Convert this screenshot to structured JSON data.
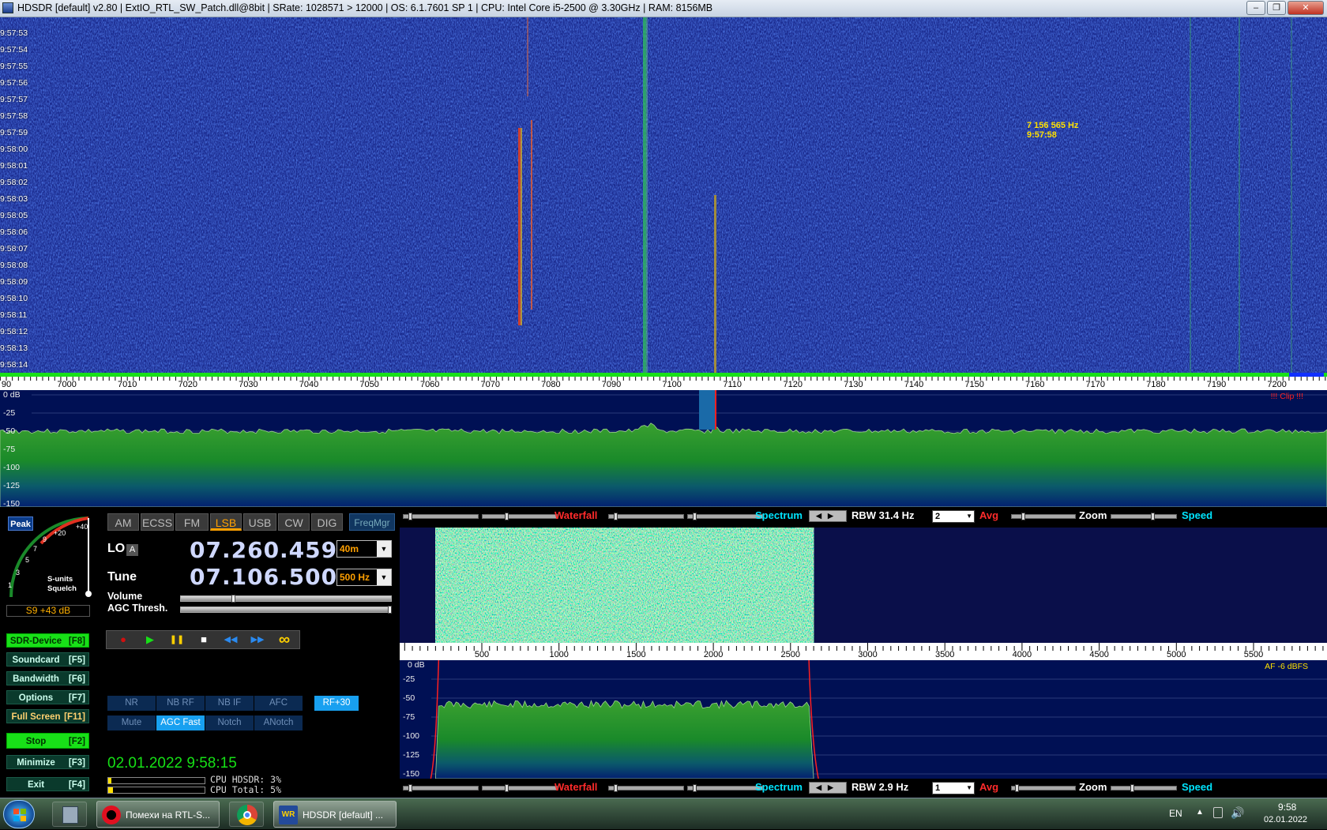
{
  "window": {
    "title": "HDSDR  [default]  v2.80   |  ExtIO_RTL_SW_Patch.dll@8bit  |  SRate: 1028571 > 12000  |  OS: 6.1.7601 SP 1  |  CPU: Intel Core i5-2500 @ 3.30GHz  |  RAM: 8156MB",
    "min_glyph": "–",
    "max_glyph": "❐",
    "close_glyph": "✕"
  },
  "waterfall": {
    "time_labels": [
      "9:57:53",
      "9:57:54",
      "9:57:55",
      "9:57:56",
      "9:57:57",
      "9:57:58",
      "9:57:59",
      "9:58:00",
      "9:58:01",
      "9:58:02",
      "9:58:03",
      "9:58:05",
      "9:58:06",
      "9:58:07",
      "9:58:08",
      "9:58:09",
      "9:58:10",
      "9:58:11",
      "9:58:12",
      "9:58:13",
      "9:58:14"
    ],
    "readout_freq": "7 156 565 Hz",
    "readout_time": "9:57:58"
  },
  "rf_scale": {
    "labels": [
      "90",
      "7000",
      "7010",
      "7020",
      "7030",
      "7040",
      "7050",
      "7060",
      "7070",
      "7080",
      "7090",
      "7100",
      "7110",
      "7120",
      "7130",
      "7140",
      "7150",
      "7160",
      "7170",
      "7180",
      "7190",
      "7200"
    ]
  },
  "rf_spectrum": {
    "db_labels": [
      "0 dB",
      "-25",
      "-50",
      "-75",
      "-100",
      "-125",
      "-150"
    ],
    "clip": "!!! Clip !!!"
  },
  "smeter": {
    "peak": "Peak",
    "scale": [
      "1",
      "3",
      "5",
      "7",
      "9",
      "+20",
      "+40"
    ],
    "caption1": "S-units",
    "caption2": "Squelch",
    "value": "S9 +43 dB"
  },
  "side_buttons": [
    {
      "label": "SDR-Device",
      "key": "[F8]"
    },
    {
      "label": "Soundcard",
      "key": "[F5]"
    },
    {
      "label": "Bandwidth",
      "key": "[F6]"
    },
    {
      "label": "Options",
      "key": "[F7]"
    },
    {
      "label": "Full Screen",
      "key": "[F11]"
    },
    {
      "label": "Stop",
      "key": "[F2]"
    },
    {
      "label": "Minimize",
      "key": "[F3]"
    },
    {
      "label": "Exit",
      "key": "[F4]"
    }
  ],
  "modes": [
    "AM",
    "ECSS",
    "FM",
    "LSB",
    "USB",
    "CW",
    "DIG"
  ],
  "freqmgr": "FreqMgr",
  "lo": {
    "label": "LO",
    "badge": "A",
    "value": "07.260.459",
    "band": "40m"
  },
  "tune": {
    "label": "Tune",
    "value": "07.106.500",
    "step": "500 Hz"
  },
  "volume_label": "Volume",
  "agc_label": "AGC Thresh.",
  "transport": {
    "rec": "●",
    "play": "▶",
    "pause": "❚❚",
    "stop": "■",
    "rew": "◀◀",
    "ff": "▶▶",
    "loop": "∞"
  },
  "dsp": {
    "row1": [
      "NR",
      "NB RF",
      "NB IF",
      "AFC"
    ],
    "rf": "RF+30",
    "row2": [
      "Mute",
      "AGC Fast",
      "Notch",
      "ANotch"
    ]
  },
  "datetime": "02.01.2022 9:58:15",
  "cpu": {
    "hdsdr": "CPU HDSDR: 3%",
    "total": "CPU Total: 5%",
    "hdsdr_frac": 0.03,
    "total_frac": 0.05
  },
  "toolbar_top": {
    "waterfall": "Waterfall",
    "spectrum": "Spectrum",
    "rbw": "RBW 31.4 Hz",
    "avg_value": "2",
    "avg": "Avg",
    "zoom": "Zoom",
    "speed": "Speed"
  },
  "toolbar_bottom": {
    "waterfall": "Waterfall",
    "spectrum": "Spectrum",
    "rbw": "RBW  2.9 Hz",
    "avg_value": "1",
    "avg": "Avg",
    "zoom": "Zoom",
    "speed": "Speed"
  },
  "af_scale": {
    "labels": [
      "500",
      "1000",
      "1500",
      "2000",
      "2500",
      "3000",
      "3500",
      "4000",
      "4500",
      "5000",
      "5500"
    ]
  },
  "af_spectrum": {
    "db_labels": [
      "-25",
      "-50",
      "-75",
      "-100",
      "-125",
      "-150"
    ],
    "top_label": "0 dB",
    "info": "AF  -6 dBFS"
  },
  "taskbar": {
    "opera_label": "Помехи на RTL-S...",
    "hdsdr_label": "HDSDR  [default]  ...",
    "hdsdr_icon_text": "WR",
    "lang": "EN",
    "time": "9:58",
    "date": "02.01.2022"
  },
  "colors": {
    "accent_orange": "#ffa000",
    "stop_green": "#18e018",
    "agc_blue": "#18a0f0",
    "waterfall_blue": "#1f2f9a"
  }
}
